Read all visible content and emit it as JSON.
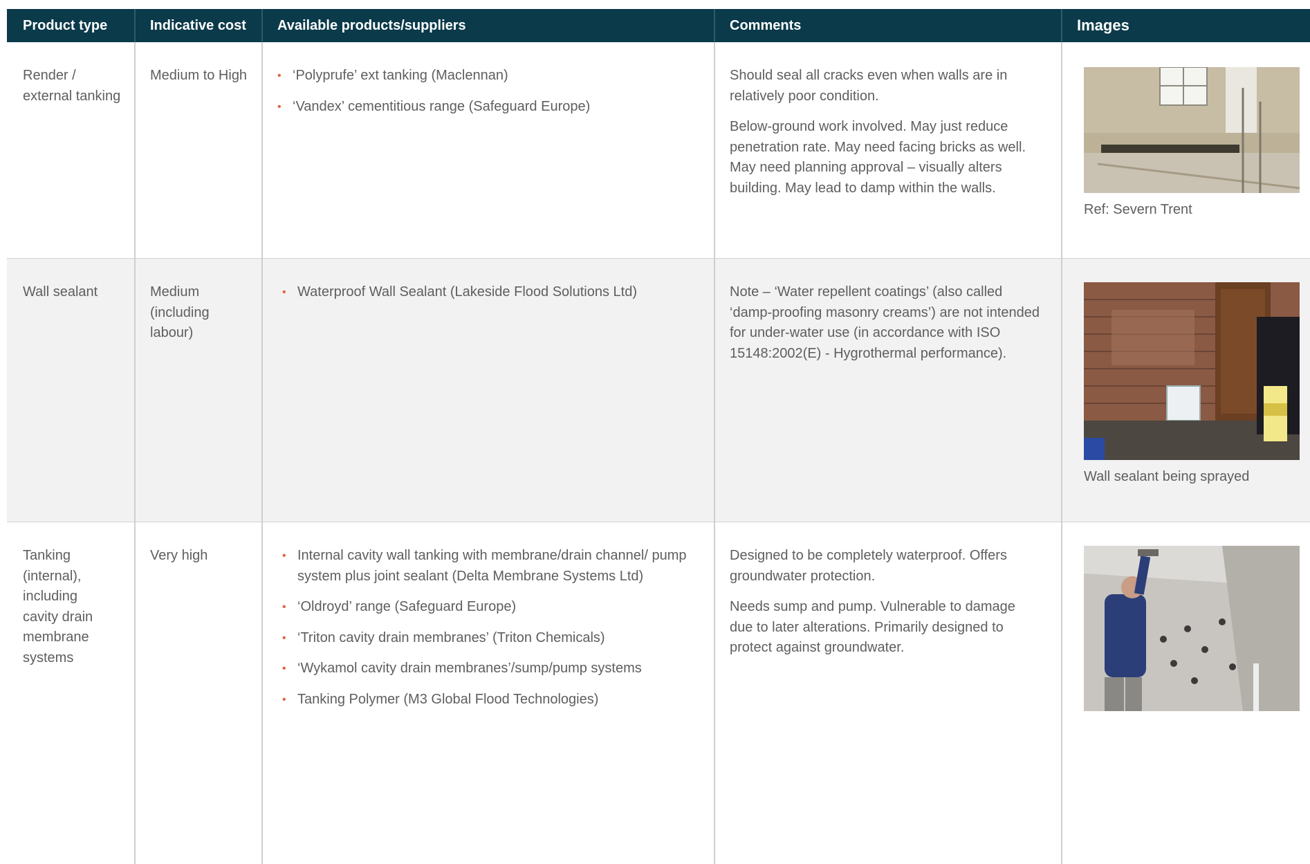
{
  "header": {
    "product_type": "Product type",
    "indicative_cost": "Indicative cost",
    "available_products": "Available products/suppliers",
    "comments": "Comments",
    "images": "Images"
  },
  "rows": [
    {
      "product_type": "Render / external tanking",
      "cost": "Medium to High",
      "products": [
        "‘Polyprufe’ ext tanking (Maclennan)",
        "‘Vandex’ cementitious range (Safeguard Europe)"
      ],
      "comments": [
        "Should seal all cracks even when walls are in relatively poor condition.",
        "Below-ground work involved. May just reduce penetration rate. May need facing bricks as well. May need planning approval – visually alters building. May lead to damp within the walls."
      ],
      "image_caption": "Ref: Severn Trent"
    },
    {
      "product_type": "Wall sealant",
      "cost": "Medium (including labour)",
      "products": [
        "Waterproof Wall Sealant (Lakeside Flood Solutions Ltd)"
      ],
      "comments": [
        "Note – ‘Water repellent coatings’ (also called ‘damp-proofing masonry creams’) are not intended for under-water use (in accordance with ISO 15148:2002(E) - Hygrothermal performance)."
      ],
      "image_caption": "Wall sealant being sprayed"
    },
    {
      "product_type": "Tanking (internal), including cavity drain membrane systems",
      "cost": "Very high",
      "products": [
        "Internal cavity wall tanking with membrane/drain channel/ pump system plus joint sealant (Delta Membrane Systems Ltd)",
        "‘Oldroyd’ range (Safeguard Europe)",
        "‘Triton cavity drain membranes’ (Triton Chemicals)",
        "‘Wykamol cavity drain membranes’/sump/pump systems",
        "Tanking Polymer (M3 Global Flood Technologies)"
      ],
      "comments": [
        "Designed to be completely waterproof. Offers groundwater protection.",
        "Needs sump and pump. Vulnerable to damage due to later alterations. Primarily designed to protect against groundwater."
      ],
      "image_caption": ""
    }
  ],
  "colors": {
    "header_bg": "#0b3a4a",
    "bullet": "#e0623c",
    "alt_row_bg": "#f2f2f2"
  }
}
